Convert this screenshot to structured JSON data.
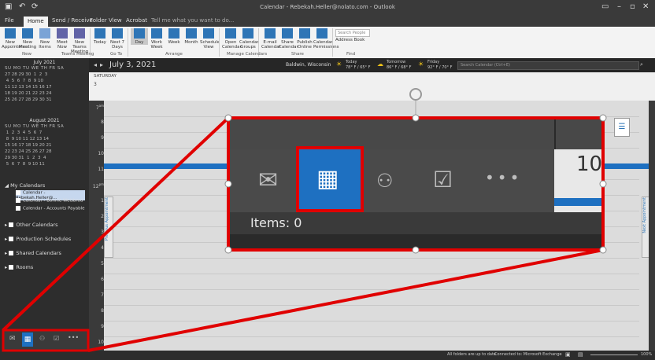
{
  "window": {
    "title": "Calendar - Rebekah.Heller@nolato.com - Outlook"
  },
  "tabs": [
    "File",
    "Home",
    "Send / Receive",
    "Folder",
    "View",
    "Acrobat"
  ],
  "tell_me": "Tell me what you want to do...",
  "ribbon": {
    "buttons": [
      {
        "label": "New Appointment"
      },
      {
        "label": "New Meeting"
      },
      {
        "label": "New Items"
      },
      {
        "label": "Meet Now"
      },
      {
        "label": "New Teams Meeting"
      },
      {
        "label": "Today"
      },
      {
        "label": "Next 7 Days"
      },
      {
        "label": "Day"
      },
      {
        "label": "Work Week"
      },
      {
        "label": "Week"
      },
      {
        "label": "Month"
      },
      {
        "label": "Schedule View"
      },
      {
        "label": "Open Calendar"
      },
      {
        "label": "Calendar Groups"
      },
      {
        "label": "E-mail Calendar"
      },
      {
        "label": "Share Calendar"
      },
      {
        "label": "Publish Online"
      },
      {
        "label": "Calendar Permissions"
      }
    ],
    "groups": [
      "New",
      "Teams Meeting",
      "Go To",
      "Arrange",
      "Manage Calendars",
      "Share",
      "Find"
    ],
    "search_people": "Search People",
    "address_book": "Address Book"
  },
  "minical": {
    "july": {
      "title": "July 2021",
      "days": "SU MO TU WE TH FR SA",
      "rows": [
        "27 28 29 30  1  2  3",
        " 4  5  6  7  8  9 10",
        "11 12 13 14 15 16 17",
        "18 19 20 21 22 23 24",
        "25 26 27 28 29 30 31"
      ]
    },
    "august": {
      "title": "August 2021",
      "days": "SU MO TU WE TH FR SA",
      "rows": [
        " 1  2  3  4  5  6  7",
        " 8  9 10 11 12 13 14",
        "15 16 17 18 19 20 21",
        "22 23 24 25 26 27 28",
        "29 30 31  1  2  3  4",
        " 5  6  7  8  9 10 11"
      ]
    }
  },
  "folders": {
    "my_calendars": "My Calendars",
    "subitems": [
      "Calendar - Rebekah.Heller@...",
      "Calendar - Bonnie Weisbrod",
      "Calendar - Accounts Payable"
    ],
    "others": [
      "Other Calendars",
      "Production Schedules",
      "Shared Calendars",
      "Rooms"
    ]
  },
  "main": {
    "date": "July 3, 2021",
    "location": "Baldwin, Wisconsin",
    "weather": [
      {
        "day": "Today",
        "temp": "78° F / 65° F"
      },
      {
        "day": "Tomorrow",
        "temp": "86° F / 68° F"
      },
      {
        "day": "Friday",
        "temp": "92° F / 70° F"
      }
    ],
    "search_placeholder": "Search Calendar (Ctrl+E)",
    "day_name": "SATURDAY",
    "day_num": "3",
    "hours": [
      "7",
      "8",
      "9",
      "10",
      "11",
      "12",
      "1",
      "2",
      "3",
      "4",
      "5",
      "6",
      "7",
      "8",
      "9",
      "10"
    ],
    "hour_suffix_am": "am",
    "hour_suffix_pm": "pm",
    "previous_appointment": "Previous Appointment",
    "next_appointment": "Next Appointment"
  },
  "zoom": {
    "items_label": "Items: 0",
    "right_number": "10"
  },
  "status": {
    "left": "All folders are up to date.",
    "right": "Connected to: Microsoft Exchange",
    "zoom": "100%"
  },
  "colors": {
    "accent": "#1e70c1",
    "highlight_red": "#e00000"
  }
}
